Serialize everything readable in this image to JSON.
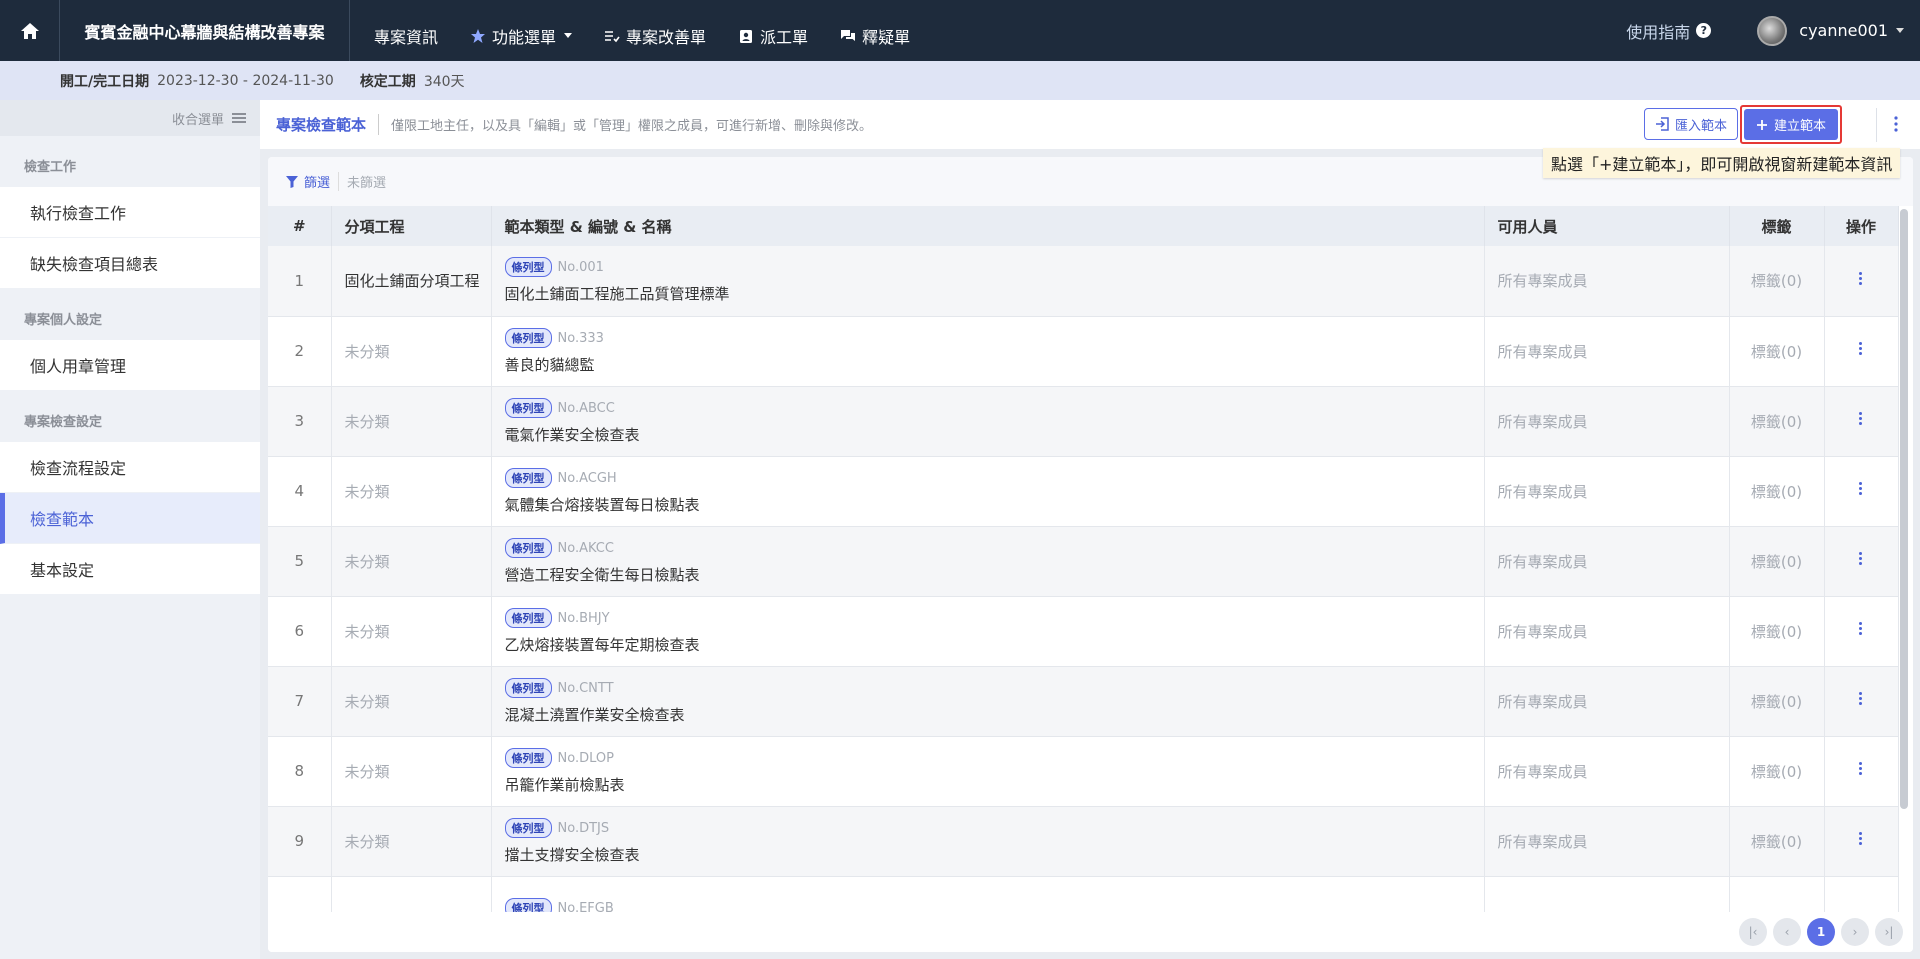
{
  "topbar": {
    "project_name": "賓賓金融中心幕牆與結構改善專案",
    "nav": [
      {
        "label": "專案資訊"
      },
      {
        "label": "功能選單"
      },
      {
        "label": "專案改善單"
      },
      {
        "label": "派工單"
      },
      {
        "label": "釋疑單"
      }
    ],
    "guide_label": "使用指南",
    "username": "cyanne001"
  },
  "infobar": {
    "period_label": "開工/完工日期",
    "period_value": "2023-12-30 - 2024-11-30",
    "duration_label": "核定工期",
    "duration_value": "340天"
  },
  "sidebar": {
    "collapse_label": "收合選單",
    "sections": [
      {
        "title": "檢查工作",
        "items": [
          "執行檢查工作",
          "缺失檢查項目總表"
        ]
      },
      {
        "title": "專案個人設定",
        "items": [
          "個人用章管理"
        ]
      },
      {
        "title": "專案檢查設定",
        "items": [
          "檢查流程設定",
          "檢查範本",
          "基本設定"
        ]
      }
    ],
    "active_item": "檢查範本"
  },
  "header": {
    "title": "專案檢查範本",
    "description": "僅限工地主任，以及具「編輯」或「管理」權限之成員，可進行新增、刪除與修改。",
    "import_label": "匯入範本",
    "create_label": "建立範本",
    "tooltip": "點選「+建立範本」，即可開啟視窗新建範本資訊"
  },
  "filter": {
    "label": "篩選",
    "state": "未篩選"
  },
  "table": {
    "headers": [
      "#",
      "分項工程",
      "範本類型 & 編號 & 名稱",
      "可用人員",
      "標籤",
      "操作"
    ],
    "rows": [
      {
        "num": "1",
        "category": "固化土鋪面分項工程",
        "type": "條列型",
        "code": "No.001",
        "name": "固化土鋪面工程施工品質管理標準",
        "users": "所有專案成員",
        "tags": "標籤(0)"
      },
      {
        "num": "2",
        "category": "未分類",
        "type": "條列型",
        "code": "No.333",
        "name": "善良的貓總監",
        "users": "所有專案成員",
        "tags": "標籤(0)"
      },
      {
        "num": "3",
        "category": "未分類",
        "type": "條列型",
        "code": "No.ABCC",
        "name": "電氣作業安全檢查表",
        "users": "所有專案成員",
        "tags": "標籤(0)"
      },
      {
        "num": "4",
        "category": "未分類",
        "type": "條列型",
        "code": "No.ACGH",
        "name": "氣體集合熔接裝置每日檢點表",
        "users": "所有專案成員",
        "tags": "標籤(0)"
      },
      {
        "num": "5",
        "category": "未分類",
        "type": "條列型",
        "code": "No.AKCC",
        "name": "營造工程安全衛生每日檢點表",
        "users": "所有專案成員",
        "tags": "標籤(0)"
      },
      {
        "num": "6",
        "category": "未分類",
        "type": "條列型",
        "code": "No.BHJY",
        "name": "乙炔熔接裝置每年定期檢查表",
        "users": "所有專案成員",
        "tags": "標籤(0)"
      },
      {
        "num": "7",
        "category": "未分類",
        "type": "條列型",
        "code": "No.CNTT",
        "name": "混凝土澆置作業安全檢查表",
        "users": "所有專案成員",
        "tags": "標籤(0)"
      },
      {
        "num": "8",
        "category": "未分類",
        "type": "條列型",
        "code": "No.DLOP",
        "name": "吊籠作業前檢點表",
        "users": "所有專案成員",
        "tags": "標籤(0)"
      },
      {
        "num": "9",
        "category": "未分類",
        "type": "條列型",
        "code": "No.DTJS",
        "name": "擋土支撐安全檢查表",
        "users": "所有專案成員",
        "tags": "標籤(0)"
      },
      {
        "num": "",
        "category": "",
        "type": "條列型",
        "code": "No.EFGB",
        "name": "",
        "users": "",
        "tags": ""
      }
    ]
  },
  "pagination": {
    "current_page": "1"
  },
  "colors": {
    "topbar": "#1e2b3c",
    "accent": "#5b6ee6",
    "highlight_border": "#e53935",
    "tooltip_bg": "#fdf5dc"
  }
}
